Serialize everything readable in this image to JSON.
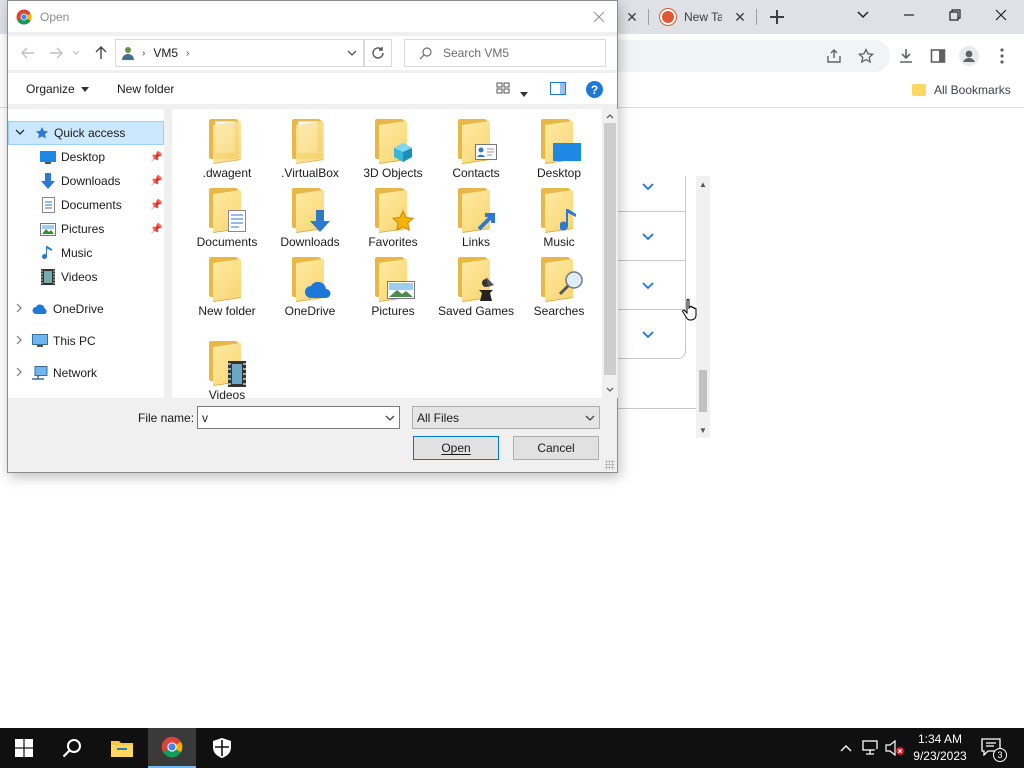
{
  "browser": {
    "tab_title": "New Ta",
    "bookmark_label": "All Bookmarks"
  },
  "dialog": {
    "title": "Open",
    "path": [
      "VM5"
    ],
    "search_placeholder": "Search VM5",
    "organize_label": "Organize",
    "new_folder_label": "New folder",
    "nav": {
      "quick_access": "Quick access",
      "quick_items": [
        "Desktop",
        "Downloads",
        "Documents",
        "Pictures",
        "Music",
        "Videos"
      ],
      "onedrive": "OneDrive",
      "this_pc": "This PC",
      "network": "Network"
    },
    "files": [
      {
        "name": ".dwagent",
        "icon": "folder-doc-icon"
      },
      {
        "name": ".VirtualBox",
        "icon": "folder-doc-icon"
      },
      {
        "name": "3D Objects",
        "icon": "folder-3d-objects-icon"
      },
      {
        "name": "Contacts",
        "icon": "folder-contacts-icon"
      },
      {
        "name": "Desktop",
        "icon": "folder-desktop-icon"
      },
      {
        "name": "Documents",
        "icon": "folder-documents-icon"
      },
      {
        "name": "Downloads",
        "icon": "folder-downloads-icon"
      },
      {
        "name": "Favorites",
        "icon": "folder-favorites-icon"
      },
      {
        "name": "Links",
        "icon": "folder-links-icon"
      },
      {
        "name": "Music",
        "icon": "folder-music-icon"
      },
      {
        "name": "New folder",
        "icon": "folder-icon"
      },
      {
        "name": "OneDrive",
        "icon": "folder-onedrive-icon"
      },
      {
        "name": "Pictures",
        "icon": "folder-pictures-icon"
      },
      {
        "name": "Saved Games",
        "icon": "folder-saved-games-icon"
      },
      {
        "name": "Searches",
        "icon": "folder-searches-icon"
      },
      {
        "name": "Videos",
        "icon": "folder-videos-icon"
      }
    ],
    "file_name_label": "File name:",
    "file_name_value": "v",
    "filter_value": "All Files",
    "open_label": "Open",
    "cancel_label": "Cancel"
  },
  "taskbar": {
    "time": "1:34 AM",
    "date": "9/23/2023",
    "notification_count": "3"
  }
}
